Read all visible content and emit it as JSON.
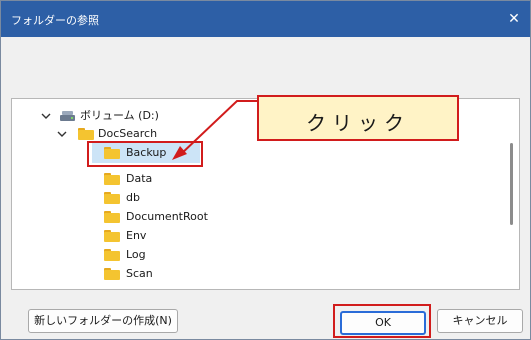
{
  "window": {
    "title": "フォルダーの参照",
    "close_glyph": "✕"
  },
  "tree": {
    "drive_label": "ボリューム (D:)",
    "root_folder": "DocSearch",
    "selected_folder": "Backup",
    "children": [
      "Data",
      "db",
      "DocumentRoot",
      "Env",
      "Log",
      "Scan"
    ]
  },
  "buttons": {
    "new_folder": "新しいフォルダーの作成(N)",
    "ok": "OK",
    "cancel": "キャンセル"
  },
  "annotation": {
    "callout_text": "クリック"
  },
  "colors": {
    "titlebar": "#2d5fa6",
    "folder": "#f4c430",
    "selection": "#cce4f7",
    "annotation_red": "#d11c1c",
    "callout_fill": "#fff3c6"
  },
  "icons": [
    "close-icon",
    "chevron-down-icon",
    "drive-icon",
    "folder-icon"
  ]
}
